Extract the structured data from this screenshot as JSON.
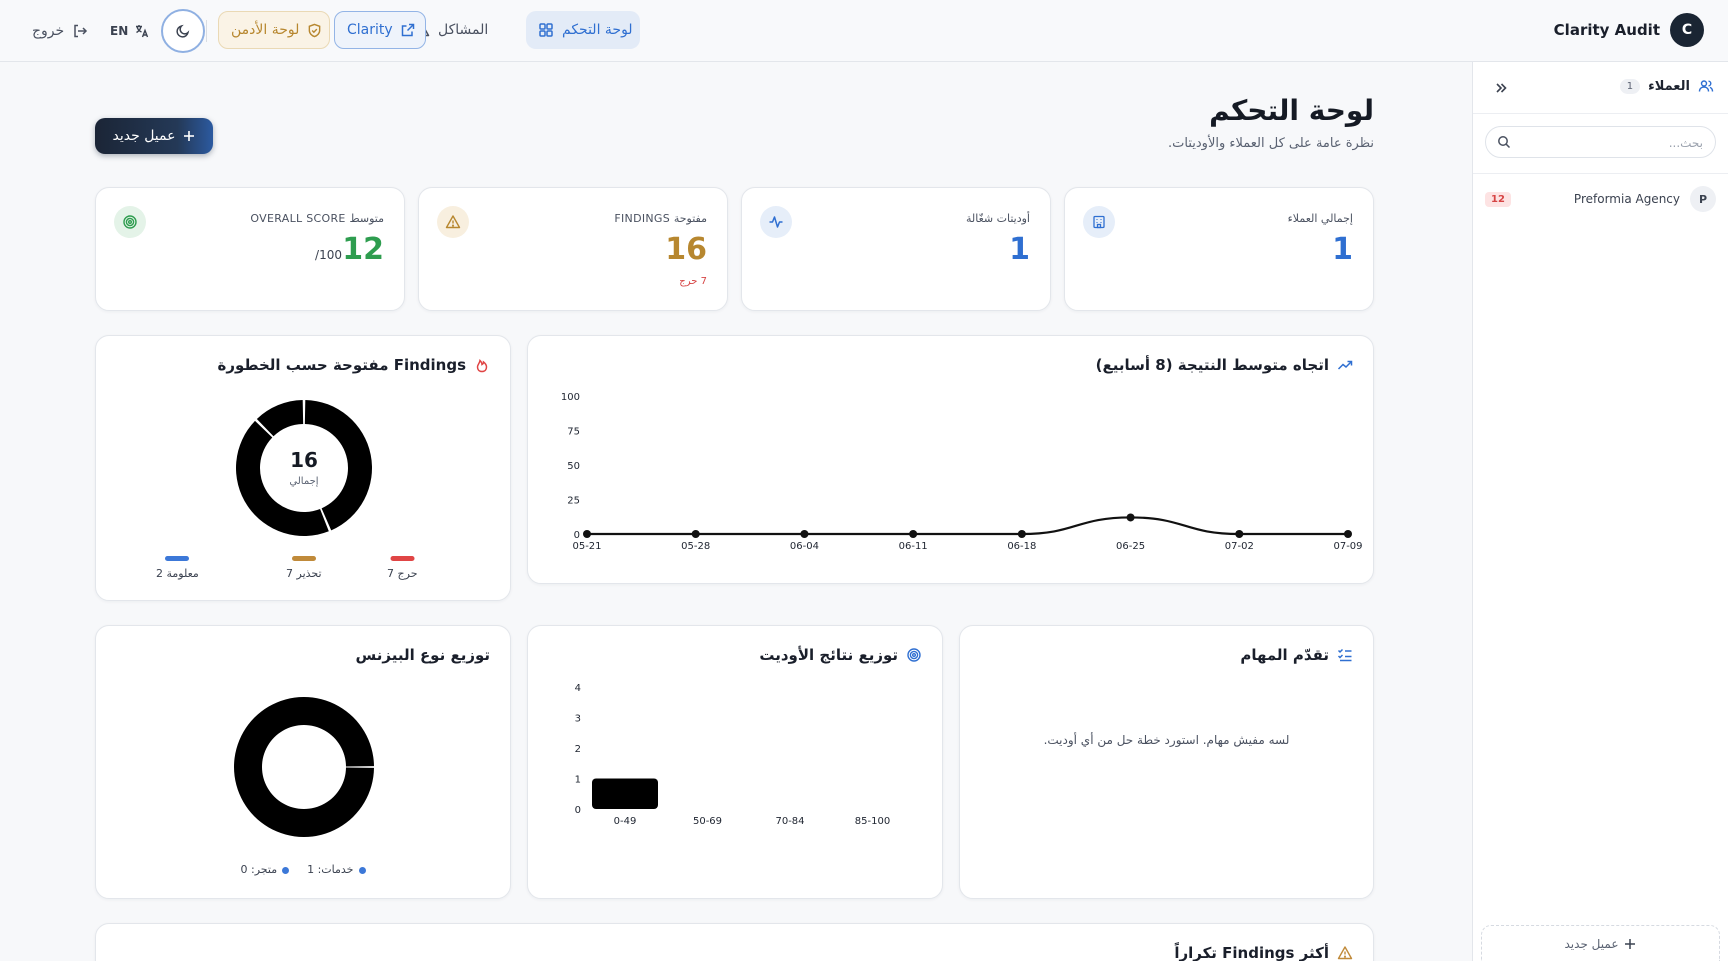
{
  "app": {
    "brand": "Clarity Audit",
    "avatar_letter": "C"
  },
  "nav": {
    "dashboard": "لوحة التحكم",
    "issues": "المشاكل",
    "clarity": "Clarity",
    "admin": "لوحة الأدمن",
    "lang": "EN",
    "logout": "خروج"
  },
  "sidebar": {
    "title": "العملاء",
    "count": "1",
    "search_placeholder": "بحث...",
    "clients": [
      {
        "avatar": "P",
        "name": "Preformia Agency",
        "badge": "12"
      }
    ],
    "new_client": "عميل جديد"
  },
  "page": {
    "title": "لوحة التحكم",
    "subtitle": "نظرة عامة على كل العملاء والأوديتات.",
    "new_client_btn": "عميل جديد"
  },
  "stats": [
    {
      "label": "إجمالي العملاء",
      "value": "1",
      "color": "#2f6fd1",
      "icon": "building-icon"
    },
    {
      "label": "أوديتات شغّالة",
      "value": "1",
      "color": "#2f6fd1",
      "icon": "activity-icon"
    },
    {
      "label": "FINDINGS مفتوحة",
      "value": "16",
      "sub": "7 حرج",
      "color": "#b7872f",
      "icon": "warning-icon"
    },
    {
      "label": "OVERALL SCORE متوسط",
      "value": "12",
      "suffix": "/100",
      "color": "#2e9d4f",
      "icon": "target-icon"
    }
  ],
  "trend_card": {
    "title": "اتجاه متوسط النتيجة (8 أسابيع)"
  },
  "severity_card": {
    "title": "Findings مفتوحة حسب الخطورة",
    "total": "16",
    "total_label": "إجمالي"
  },
  "results_card": {
    "title": "توزيع نتائج الأوديت"
  },
  "tasks_card": {
    "title": "تقدّم المهام",
    "empty": "لسه مفيش مهام. استورد خطة حل من أي أوديت."
  },
  "business_card": {
    "title": "توزيع نوع البيزنس",
    "legend": [
      "متجر: 0",
      "خدمات: 1"
    ]
  },
  "recurring_card": {
    "title": "أكثر Findings تكراراً"
  },
  "colors": {
    "critical": "#e04545",
    "warning": "#c08a3a",
    "info": "#3c78d8",
    "accent": "#2f6fd1"
  },
  "chart_data": [
    {
      "type": "line",
      "title": "اتجاه متوسط النتيجة (8 أسابيع)",
      "x": [
        "05-21",
        "05-28",
        "06-04",
        "06-11",
        "06-18",
        "06-25",
        "07-02",
        "07-09"
      ],
      "values": [
        0,
        0,
        0,
        0,
        0,
        12,
        0,
        0
      ],
      "ylim": [
        0,
        100
      ],
      "yticks": [
        "0",
        "25",
        "50",
        "75",
        "100"
      ]
    },
    {
      "type": "pie",
      "title": "Findings مفتوحة حسب الخطورة",
      "categories": [
        "7 حرج",
        "7 تحذير",
        "2 معلومة"
      ],
      "values": [
        7,
        7,
        2
      ]
    },
    {
      "type": "bar",
      "title": "توزيع نتائج الأوديت",
      "categories": [
        "0-49",
        "50-69",
        "70-84",
        "85-100"
      ],
      "values": [
        1,
        0,
        0,
        0
      ],
      "ylim": [
        0,
        4
      ],
      "yticks": [
        "0",
        "1",
        "2",
        "3",
        "4"
      ]
    },
    {
      "type": "pie",
      "title": "توزيع نوع البيزنس",
      "categories": [
        "متجر",
        "خدمات"
      ],
      "values": [
        0,
        1
      ]
    }
  ]
}
